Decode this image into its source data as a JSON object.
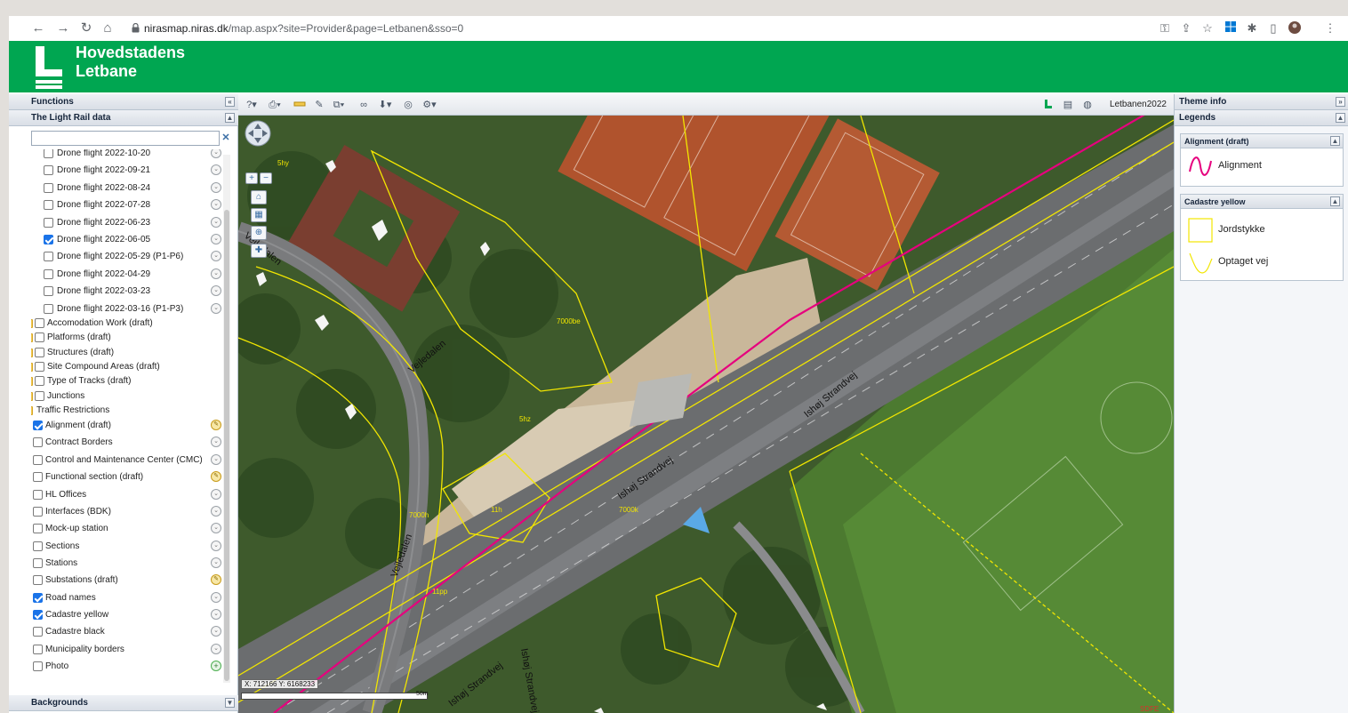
{
  "browser": {
    "url_host": "nirasmap.niras.dk",
    "url_path": "/map.aspx?site=Provider&page=Letbanen&sso=0"
  },
  "banner": {
    "brand_line1": "Hovedstadens",
    "brand_line2": "Letbane",
    "color": "#00a651"
  },
  "left_panel": {
    "functions_title": "Functions",
    "section_title": "The Light Rail data",
    "search_placeholder": "",
    "backgrounds_title": "Backgrounds",
    "drone_flights": [
      {
        "label": "Drone flight 2022-10-20",
        "checked": false
      },
      {
        "label": "Drone flight 2022-09-21",
        "checked": false
      },
      {
        "label": "Drone flight 2022-08-24",
        "checked": false
      },
      {
        "label": "Drone flight 2022-07-28",
        "checked": false
      },
      {
        "label": "Drone flight 2022-06-23",
        "checked": false
      },
      {
        "label": "Drone flight 2022-06-05",
        "checked": true
      },
      {
        "label": "Drone flight 2022-05-29 (P1-P6)",
        "checked": false
      },
      {
        "label": "Drone flight 2022-04-29",
        "checked": false
      },
      {
        "label": "Drone flight 2022-03-23",
        "checked": false
      },
      {
        "label": "Drone flight 2022-03-16 (P1-P3)",
        "checked": false
      }
    ],
    "folders": [
      {
        "label": "Accomodation Work (draft)",
        "checkbox": true
      },
      {
        "label": "Platforms (draft)",
        "checkbox": true
      },
      {
        "label": "Structures (draft)",
        "checkbox": true
      },
      {
        "label": "Site Compound Areas (draft)",
        "checkbox": true
      },
      {
        "label": "Type of Tracks (draft)",
        "checkbox": true
      },
      {
        "label": "Junctions",
        "checkbox": true
      },
      {
        "label": "Traffic Restrictions",
        "checkbox": false
      }
    ],
    "layers": [
      {
        "label": "Alignment (draft)",
        "checked": true,
        "icon": "gold"
      },
      {
        "label": "Contract Borders",
        "checked": false,
        "icon": "grey"
      },
      {
        "label": "Control and Maintenance Center (CMC)",
        "checked": false,
        "icon": "grey"
      },
      {
        "label": "Functional section (draft)",
        "checked": false,
        "icon": "gold"
      },
      {
        "label": "HL Offices",
        "checked": false,
        "icon": "grey"
      },
      {
        "label": "Interfaces (BDK)",
        "checked": false,
        "icon": "grey"
      },
      {
        "label": "Mock-up station",
        "checked": false,
        "icon": "grey"
      },
      {
        "label": "Sections",
        "checked": false,
        "icon": "grey"
      },
      {
        "label": "Stations",
        "checked": false,
        "icon": "grey"
      },
      {
        "label": "Substations (draft)",
        "checked": false,
        "icon": "gold"
      },
      {
        "label": "Road names",
        "checked": true,
        "icon": "grey"
      },
      {
        "label": "Cadastre yellow",
        "checked": true,
        "icon": "grey"
      },
      {
        "label": "Cadastre black",
        "checked": false,
        "icon": "grey"
      },
      {
        "label": "Municipality borders",
        "checked": false,
        "icon": "grey"
      },
      {
        "label": "Photo",
        "checked": false,
        "icon": "green"
      }
    ]
  },
  "map": {
    "toolbar_user": "Letbanen2022",
    "coords_readout": "X: 712166 Y: 6168233",
    "scale_label": "50m",
    "labels": {
      "road1": "Ishøj Strandvej",
      "road2": "Ishøj Strandvej",
      "road3": "Vejledalen",
      "road4": "Vejledalen",
      "road5": "Vejledalen",
      "road6": "Ishøj Strandvej",
      "road7": "Ishøj Strandvej",
      "parcel1": "7000be",
      "parcel2": "5hz",
      "parcel3": "7000k",
      "parcel4": "11h",
      "parcel5": "7000h",
      "parcel6": "5hy",
      "parcel7": "11pp",
      "sdfe": "SDFE"
    }
  },
  "right_panel": {
    "title": "Theme info",
    "legends_title": "Legends",
    "groups": [
      {
        "title": "Alignment (draft)",
        "items": [
          {
            "label": "Alignment"
          }
        ]
      },
      {
        "title": "Cadastre yellow",
        "items": [
          {
            "label": "Jordstykke"
          },
          {
            "label": "Optaget vej"
          }
        ]
      }
    ],
    "alignment_color": "#e6007e",
    "cadastre_color": "#f2e600"
  }
}
